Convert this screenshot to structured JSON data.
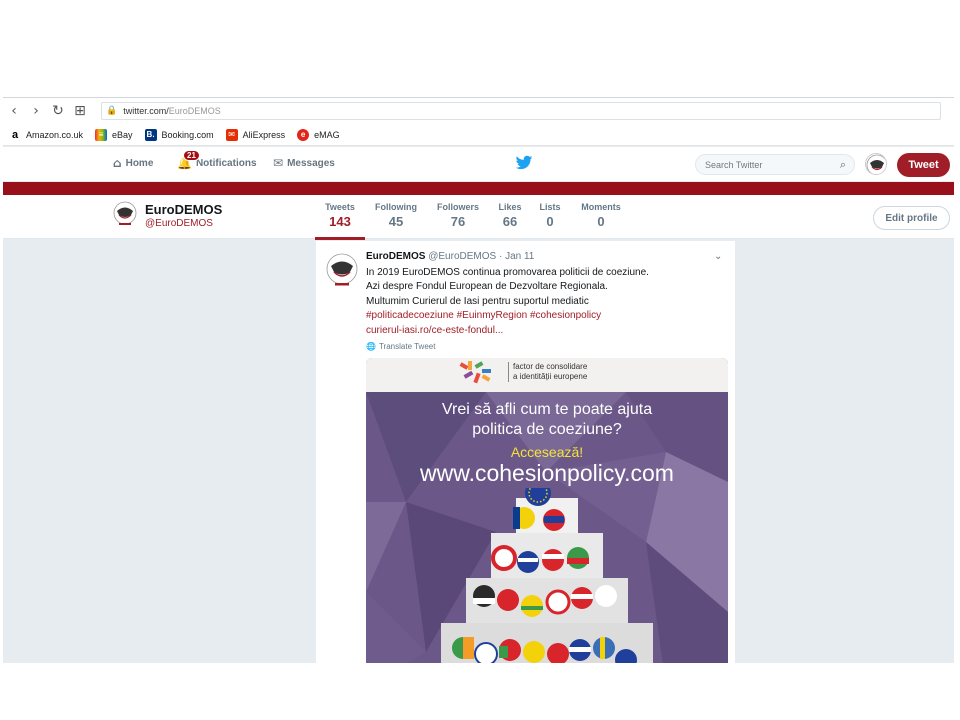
{
  "browser": {
    "nav": {
      "back": "‹",
      "forward": "›",
      "reload": "↻",
      "apps": "⊞"
    },
    "url": {
      "host": "twitter.com/",
      "path": "EuroDEMOS"
    },
    "bookmarks": [
      {
        "label": "Amazon.co.uk",
        "icon": "a",
        "color": "#000000"
      },
      {
        "label": "eBay",
        "icon": "≡",
        "color": "#e53238"
      },
      {
        "label": "Booking.com",
        "icon": "B.",
        "color": "#003580"
      },
      {
        "label": "AliExpress",
        "icon": "✉",
        "color": "#e62e04"
      },
      {
        "label": "eMAG",
        "icon": "e",
        "color": "#e1251b"
      }
    ]
  },
  "twitter_nav": {
    "home": "Home",
    "notifications": "Notifications",
    "notifications_badge": "21",
    "messages": "Messages",
    "search_placeholder": "Search Twitter",
    "tweet_button": "Tweet",
    "accent_color": "#a01e28"
  },
  "profile": {
    "name": "EuroDEMOS",
    "handle": "@EuroDEMOS",
    "edit_profile": "Edit profile",
    "stats": [
      {
        "label": "Tweets",
        "value": "143",
        "active": true
      },
      {
        "label": "Following",
        "value": "45"
      },
      {
        "label": "Followers",
        "value": "76"
      },
      {
        "label": "Likes",
        "value": "66"
      },
      {
        "label": "Lists",
        "value": "0"
      },
      {
        "label": "Moments",
        "value": "0"
      }
    ]
  },
  "tweet": {
    "author": "EuroDEMOS",
    "handle": "@EuroDEMOS",
    "date": "· Jan 11",
    "lines": [
      "In 2019 EuroDEMOS continua promovarea politicii de coeziune.",
      "Azi despre Fondul European de Dezvoltare Regionala.",
      "Multumim Curierul de Iasi pentru suportul mediatic"
    ],
    "hashtags": "#politicadecoeziune #EuinmyRegion #cohesionpolicy",
    "link": "curierul-iasi.ro/ce-este-fondul...",
    "translate": "Translate Tweet",
    "media": {
      "caption_line1": "factor de consolidare",
      "caption_line2": "a identității europene",
      "headline_line1": "Vrei să afli cum te poate ajuta",
      "headline_line2": "politica de coeziune?",
      "cta": "Accesează!",
      "url": "www.cohesionpolicy.com"
    }
  }
}
